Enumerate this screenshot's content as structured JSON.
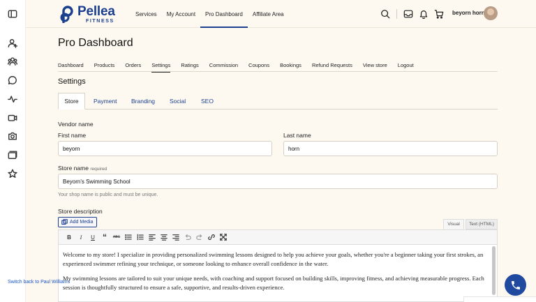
{
  "brand": {
    "name": "Pellea",
    "sub": "FITNESS",
    "color": "#1a3f8f"
  },
  "nav": {
    "links": [
      "Services",
      "My Account",
      "Pro Dashboard",
      "Affiliate Area"
    ],
    "active": "Pro Dashboard",
    "user": "beyorn horn"
  },
  "page": {
    "title": "Pro Dashboard"
  },
  "subtabs": [
    "Dashboard",
    "Products",
    "Orders",
    "Settings",
    "Ratings",
    "Commission",
    "Coupons",
    "Bookings",
    "Refund Requests",
    "View store",
    "Logout"
  ],
  "active_subtab": "Settings",
  "settings": {
    "title": "Settings",
    "tabs": [
      "Store",
      "Payment",
      "Branding",
      "Social",
      "SEO"
    ],
    "active_tab": "Store"
  },
  "form": {
    "vendor_name_label": "Vendor name",
    "first_name_label": "First name",
    "first_name_value": "beyorn",
    "last_name_label": "Last name",
    "last_name_value": "horn",
    "store_name_label": "Store name",
    "store_name_required": "required",
    "store_name_value": "Beyorn's Swimming School",
    "store_name_hint": "Your shop name is public and must be unique.",
    "store_desc_label": "Store description",
    "add_media": "Add Media",
    "editor_tab_visual": "Visual",
    "editor_tab_html": "Text (HTML)",
    "description_paragraphs": [
      "Welcome to my store! I specialize in providing personalized swimming lessons designed to help you achieve your goals, whether you're a beginner taking your first strokes, an experienced swimmer refining your technique, or someone looking to enhance overall confidence in the water.",
      "My swimming lessons are tailored to suit your unique needs, with coaching and support focused on building skills, improving fitness, and achieving measurable progress. Each session is thoughtfully structured to ensure a safe, supportive, and results-driven experience."
    ]
  },
  "footer": {
    "switch_back": "Switch back to Paul Williams"
  },
  "icons": {
    "rail": [
      "sidebar-toggle-icon",
      "user-add-icon",
      "users-icon",
      "chat-icon",
      "activity-icon",
      "video-icon",
      "camera-icon",
      "folders-icon",
      "star-icon"
    ],
    "header": [
      "search-icon",
      "inbox-icon",
      "bell-icon",
      "cart-icon"
    ],
    "toolbar": [
      "bold-icon",
      "italic-icon",
      "underline-icon",
      "blockquote-icon",
      "strikethrough-icon",
      "bullet-list-icon",
      "numbered-list-icon",
      "align-left-icon",
      "align-center-icon",
      "align-right-icon",
      "undo-icon",
      "redo-icon",
      "link-icon",
      "fullscreen-icon"
    ]
  }
}
